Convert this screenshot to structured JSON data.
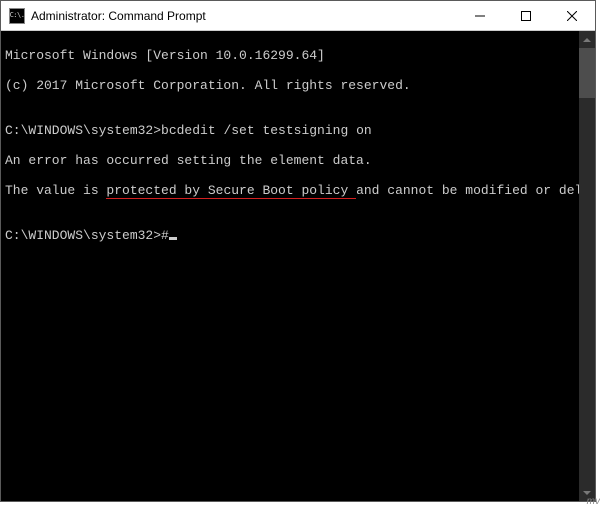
{
  "window": {
    "title": "Administrator: Command Prompt",
    "iconText": "C:\\."
  },
  "console": {
    "line1": "Microsoft Windows [Version 10.0.16299.64]",
    "line2": "(c) 2017 Microsoft Corporation. All rights reserved.",
    "blank1": "",
    "prompt1_path": "C:\\WINDOWS\\system32>",
    "prompt1_cmd": "bcdedit /set testsigning on",
    "err1": "An error has occurred setting the element data.",
    "err2_a": "The value is ",
    "err2_b": "protected by Secure Boot policy ",
    "err2_c": "and cannot be modified or deleted.",
    "blank2": "",
    "prompt2_path": "C:\\WINDOWS\\system32>",
    "prompt2_cmd": "#"
  },
  "watermark": "mv"
}
